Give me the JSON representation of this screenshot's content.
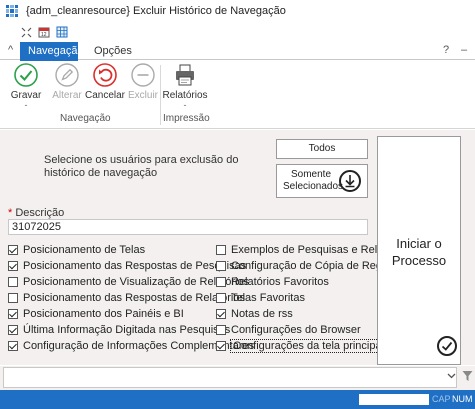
{
  "window": {
    "title": "{adm_cleanresource} Excluir Histórico de Navegação"
  },
  "tabs": {
    "collapse": "^",
    "active": "Navegação",
    "second": "Opções",
    "help": "?",
    "minimize": "–"
  },
  "ribbon": {
    "gravar": "Gravar",
    "alterar": "Alterar",
    "cancelar": "Cancelar",
    "excluir": "Excluir",
    "relatorios": "Relatórios",
    "dash": "-",
    "group_navegacao": "Navegação",
    "group_impressao": "Impressão"
  },
  "main": {
    "select_text": "Selecione os usuários para exclusão do histórico de navegação",
    "todos": "Todos",
    "somente": "Somente Selecionados",
    "descricao_label": "Descrição",
    "descricao_required": "*",
    "descricao_value": "31072025",
    "iniciar": "Iniciar o Processo"
  },
  "options_left": [
    {
      "label": "Posicionamento de Telas",
      "checked": true
    },
    {
      "label": "Posicionamento das Respostas de Pesquisas",
      "checked": true
    },
    {
      "label": "Posicionamento de Visualização de Relatórios",
      "checked": false
    },
    {
      "label": "Posicionamento das Respostas de Relatórios",
      "checked": false
    },
    {
      "label": "Posicionamento dos Painéis e BI",
      "checked": true
    },
    {
      "label": "Última Informação Digitada nas Pesquisas",
      "checked": true
    },
    {
      "label": "Configuração de Informações Complementares",
      "checked": true
    }
  ],
  "options_right": [
    {
      "label": "Exemplos de Pesquisas e Relatórios",
      "checked": false
    },
    {
      "label": "Configuração de Cópia de Registros",
      "checked": false
    },
    {
      "label": "Relatórios Favoritos",
      "checked": false
    },
    {
      "label": "Telas Favoritas",
      "checked": false
    },
    {
      "label": "Notas de rss",
      "checked": true
    },
    {
      "label": "Configurações do Browser",
      "checked": false
    },
    {
      "label": "Configurações da tela principal",
      "checked": true
    }
  ],
  "statusbar": {
    "cap": "CAP",
    "num": "NUM"
  },
  "colors": {
    "accent": "#1f6fc4",
    "panel": "#f3f0ef",
    "gravar": "#2aa14a",
    "cancelar": "#d9302c"
  }
}
